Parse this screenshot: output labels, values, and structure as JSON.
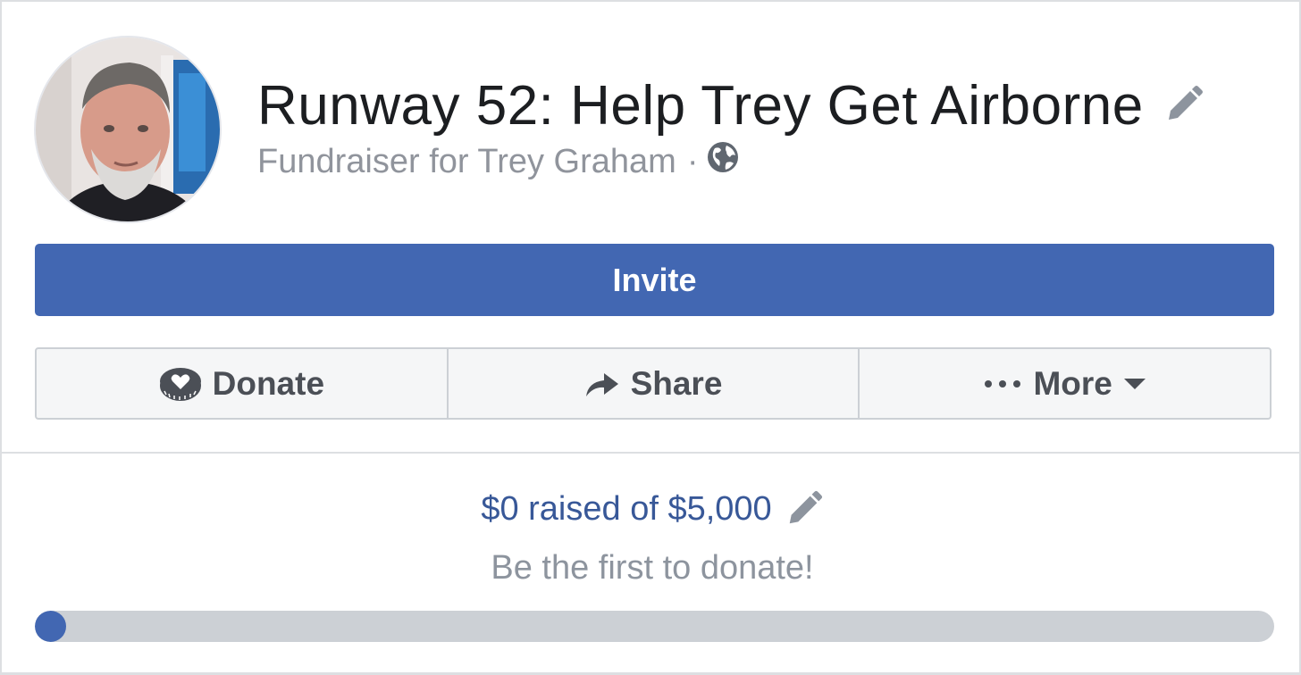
{
  "fundraiser": {
    "title": "Runway 52: Help Trey Get Airborne",
    "subtitle": "Fundraiser for Trey Graham",
    "subtitle_separator": "·",
    "privacy_icon": "globe-icon",
    "edit_icon": "pencil-icon"
  },
  "buttons": {
    "invite": "Invite",
    "donate": "Donate",
    "share": "Share",
    "more": "More",
    "more_prefix": "•••"
  },
  "progress": {
    "raised_text": "$0 raised of $5,000",
    "cta": "Be the first to donate!",
    "raised_amount": 0,
    "goal_amount": 5000
  },
  "colors": {
    "brand_blue": "#4267b2",
    "link_blue": "#385898",
    "text_dark": "#1c1e21",
    "text_gray": "#90949c",
    "button_bg": "#f5f6f7",
    "progress_track": "#ccd0d5"
  }
}
